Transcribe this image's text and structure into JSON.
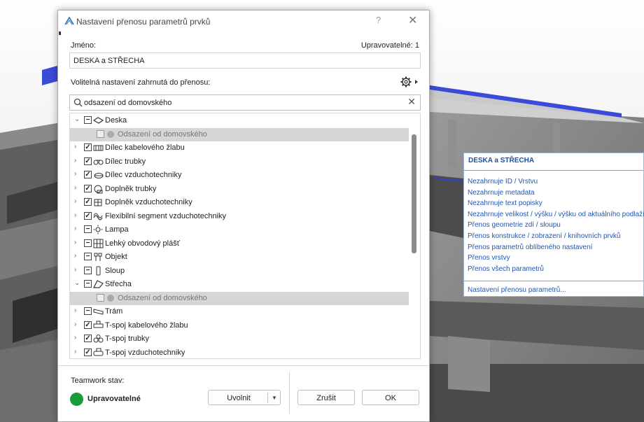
{
  "dialog": {
    "title": "Nastavení přenosu parametrů prvků",
    "help": "?",
    "close": "✕",
    "name_label": "Jméno:",
    "editable_label": "Upravovatelné: 1",
    "name_value": "DESKA a STŘECHA",
    "optional_label": "Volitelná nastavení zahrnutá do přenosu:",
    "search": {
      "value": "odsazení od domovského",
      "clear": "✕"
    },
    "tree": [
      {
        "label": "Deska",
        "level": 0,
        "expanded": true,
        "check": "minus",
        "icon": "slab-icon"
      },
      {
        "label": "Odsazení od domovského",
        "level": 1,
        "check": "gray",
        "dim": true
      },
      {
        "label": "Dílec kabelového žlabu",
        "level": 0,
        "expanded": false,
        "check": "checked",
        "icon": "cable-tray-icon"
      },
      {
        "label": "Dílec trubky",
        "level": 0,
        "expanded": false,
        "check": "checked",
        "icon": "pipe-icon"
      },
      {
        "label": "Dílec vzduchotechniky",
        "level": 0,
        "expanded": false,
        "check": "checked",
        "icon": "duct-icon"
      },
      {
        "label": "Doplněk trubky",
        "level": 0,
        "expanded": false,
        "check": "checked",
        "icon": "pipe-accessory-icon"
      },
      {
        "label": "Doplněk vzduchotechniky",
        "level": 0,
        "expanded": false,
        "check": "checked",
        "icon": "duct-accessory-icon"
      },
      {
        "label": "Flexibilní segment vzduchotechniky",
        "level": 0,
        "expanded": false,
        "check": "checked",
        "icon": "flex-duct-icon"
      },
      {
        "label": "Lampa",
        "level": 0,
        "expanded": false,
        "check": "minus",
        "icon": "lamp-icon"
      },
      {
        "label": "Lehký obvodový plášť",
        "level": 0,
        "expanded": false,
        "check": "minus",
        "icon": "curtain-wall-icon"
      },
      {
        "label": "Objekt",
        "level": 0,
        "expanded": false,
        "check": "minus",
        "icon": "object-icon"
      },
      {
        "label": "Sloup",
        "level": 0,
        "expanded": false,
        "check": "minus",
        "icon": "column-icon"
      },
      {
        "label": "Střecha",
        "level": 0,
        "expanded": true,
        "check": "minus",
        "icon": "roof-icon"
      },
      {
        "label": "Odsazení od domovského",
        "level": 1,
        "check": "gray",
        "dim": true
      },
      {
        "label": "Trám",
        "level": 0,
        "expanded": false,
        "check": "minus",
        "icon": "beam-icon"
      },
      {
        "label": "T-spoj kabelového žlabu",
        "level": 0,
        "expanded": false,
        "check": "checked",
        "icon": "cable-tray-tee-icon"
      },
      {
        "label": "T-spoj trubky",
        "level": 0,
        "expanded": false,
        "check": "checked",
        "icon": "pipe-tee-icon"
      },
      {
        "label": "T-spoj vzduchotechniky",
        "level": 0,
        "expanded": false,
        "check": "checked",
        "icon": "duct-tee-icon"
      }
    ],
    "teamwork_label": "Teamwork stav:",
    "teamwork_status": "Upravovatelné",
    "release_label": "Uvolnit",
    "cancel_label": "Zrušit",
    "ok_label": "OK",
    "status_color": "#1a9b3c"
  },
  "menu": {
    "title": "DESKA a STŘECHA",
    "items": [
      "Nezahrnuje ID / Vrstvu",
      "Nezahrnuje metadata",
      "Nezahrnuje text popisky",
      "Nezahrnuje velikost / výšku / výšku od aktuálního podlaží",
      "Přenos geometrie zdí / sloupu",
      "Přenos konstrukce / zobrazení / knihovních prvků",
      "Přenos parametrů oblíbeného nastavení",
      "Přenos vrstvy",
      "Přenos všech parametrů"
    ],
    "footer": "Nastavení přenosu parametrů..."
  },
  "colors": {
    "accent": "#1f4fa0",
    "link": "#2057b3",
    "slab_edge": "#2a3fd6"
  }
}
